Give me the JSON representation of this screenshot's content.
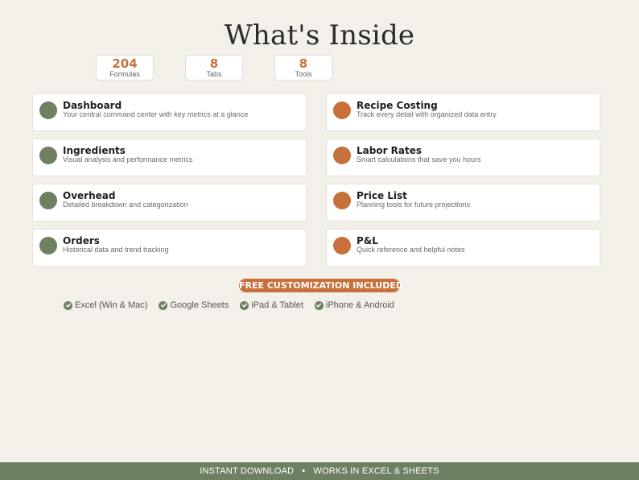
{
  "header": {
    "title": "What's Inside"
  },
  "stats": [
    {
      "value": "204",
      "label": "Formulas"
    },
    {
      "value": "8",
      "label": "Tabs"
    },
    {
      "value": "8",
      "label": "Tools"
    }
  ],
  "features": {
    "left": [
      {
        "title": "Dashboard",
        "description": "Your central command center with key metrics at a glance",
        "dot_color": "#6e8062"
      },
      {
        "title": "Ingredients",
        "description": "Visual analysis and performance metrics",
        "dot_color": "#6e8062"
      },
      {
        "title": "Overhead",
        "description": "Detailed breakdown and categorization",
        "dot_color": "#6e8062"
      },
      {
        "title": "Orders",
        "description": "Historical data and trend tracking",
        "dot_color": "#6e8062"
      }
    ],
    "right": [
      {
        "title": "Recipe Costing",
        "description": "Track every detail with organized data entry",
        "dot_color": "#c8703b"
      },
      {
        "title": "Labor Rates",
        "description": "Smart calculations that save you hours",
        "dot_color": "#c8703b"
      },
      {
        "title": "Price List",
        "description": "Planning tools for future projections",
        "dot_color": "#c8703b"
      },
      {
        "title": "P&L",
        "description": "Quick reference and helpful notes",
        "dot_color": "#c8703b"
      }
    ]
  },
  "customization": {
    "label": "FREE CUSTOMIZATION INCLUDED"
  },
  "compatibility": [
    {
      "label": "Excel (Win & Mac)",
      "icon": "check-circle-icon"
    },
    {
      "label": "Google Sheets",
      "icon": "check-circle-icon"
    },
    {
      "label": "iPad & Tablet",
      "icon": "check-circle-icon"
    },
    {
      "label": "iPhone & Android",
      "icon": "check-circle-icon"
    }
  ],
  "footer": {
    "left": "INSTANT DOWNLOAD",
    "separator": "•",
    "right": "WORKS IN EXCEL & SHEETS"
  },
  "colors": {
    "accent": "#c8703b",
    "green": "#6e8062",
    "background": "#f3efe9"
  }
}
